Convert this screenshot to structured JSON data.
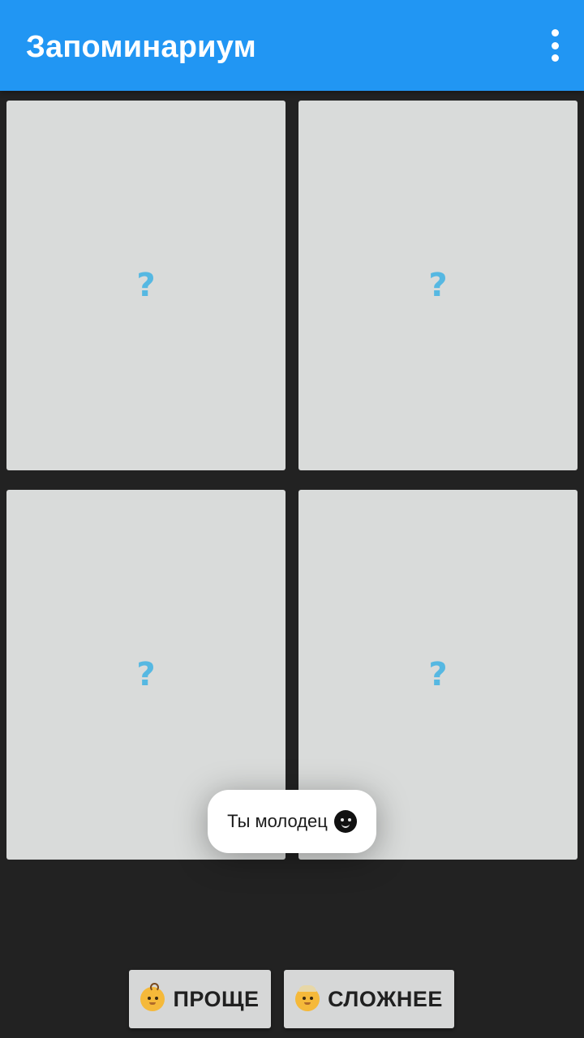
{
  "appbar": {
    "title": "Запоминариум",
    "overflow_icon": "more-vert-icon",
    "color": "#2196F3"
  },
  "cards": [
    {
      "face": "?"
    },
    {
      "face": "?"
    },
    {
      "face": "?"
    },
    {
      "face": "?"
    }
  ],
  "toast": {
    "message": "Ты молодец",
    "icon": "new-moon-face-icon"
  },
  "buttons": {
    "easier": {
      "label": "ПРОЩЕ",
      "icon": "baby-icon"
    },
    "harder": {
      "label": "СЛОЖНЕЕ",
      "icon": "older-person-icon"
    }
  },
  "colors": {
    "background": "#222222",
    "card": "#D9DBDA",
    "question_mark": "#56B8E2",
    "button": "#D6D7D7"
  }
}
